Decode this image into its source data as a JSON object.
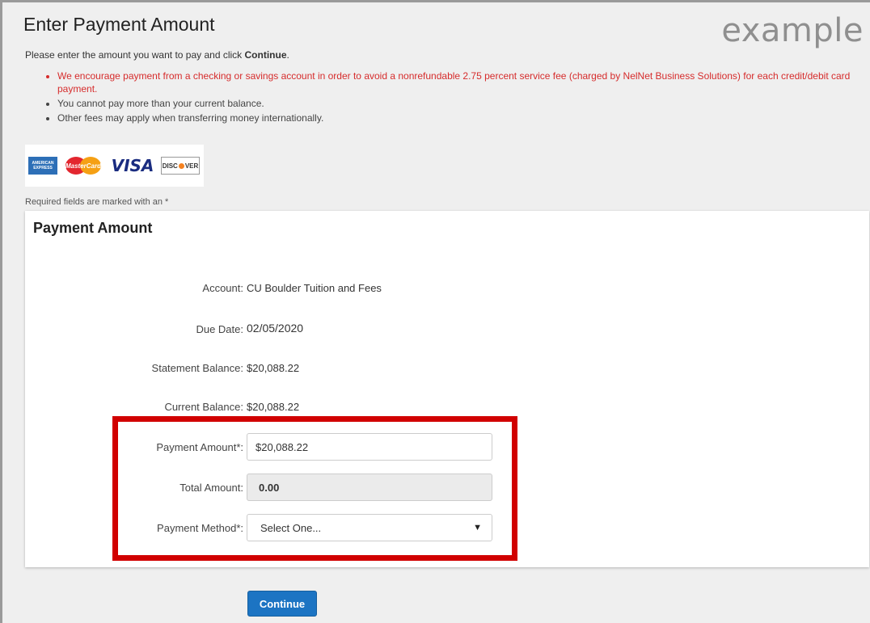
{
  "page": {
    "title": "Enter Payment Amount",
    "watermark": "example",
    "instructions_prefix": "Please enter the amount you want to pay and click ",
    "instructions_bold": "Continue",
    "instructions_suffix": ".",
    "notes": [
      "We encourage payment from a checking or savings account in order to avoid a nonrefundable 2.75 percent service fee (charged by NelNet Business Solutions) for each credit/debit card payment.",
      "You cannot pay more than your current balance.",
      "Other fees may apply when transferring money internationally."
    ],
    "cards": {
      "amex_line1": "AMERICAN",
      "amex_line2": "EXPRESS",
      "mastercard": "MasterCard",
      "visa": "VISA",
      "discover_pre": "DISC",
      "discover_post": "VER"
    },
    "required_note": "Required fields are marked with an *"
  },
  "panel": {
    "heading": "Payment Amount",
    "account_label": "Account:",
    "account_value": "CU Boulder Tuition and Fees",
    "due_label": "Due Date:",
    "due_value": "02/05/2020",
    "statement_label": "Statement Balance:",
    "statement_value": "$20,088.22",
    "current_label": "Current Balance:",
    "current_value": "$20,088.22",
    "payment_label": "Payment Amount*:",
    "payment_value": "$20,088.22",
    "total_label": "Total Amount:",
    "total_value": "0.00",
    "method_label": "Payment Method*:",
    "method_selected": "Select One..."
  },
  "actions": {
    "continue_label": "Continue"
  },
  "colors": {
    "warning_text": "#d62c2c",
    "highlight_border": "#d10000",
    "button_bg": "#1c74c3"
  }
}
